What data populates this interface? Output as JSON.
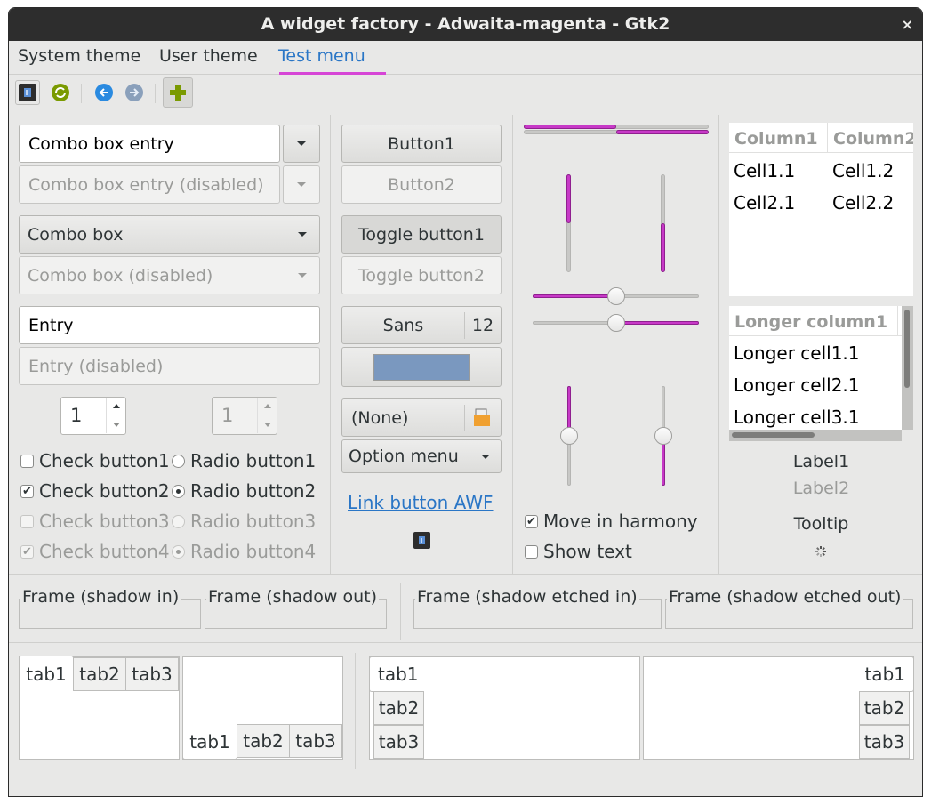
{
  "window": {
    "title": "A widget factory - Adwaita-magenta - Gtk2",
    "close_glyph": "×"
  },
  "menubar": {
    "items": [
      "System theme",
      "User theme",
      "Test menu"
    ],
    "active_index": 2
  },
  "toolbar": {
    "buttons": [
      {
        "icon": "application-icon",
        "glyph": "▮"
      },
      {
        "icon": "refresh-icon",
        "glyph": "⟳"
      },
      {
        "icon": "back-icon",
        "glyph": "←"
      },
      {
        "icon": "forward-icon",
        "glyph": "→"
      },
      {
        "icon": "add-icon",
        "glyph": "✚"
      }
    ]
  },
  "left": {
    "combo_entry": {
      "value": "Combo box entry"
    },
    "combo_entry_disabled": {
      "value": "Combo box entry (disabled)"
    },
    "combo": {
      "value": "Combo box"
    },
    "combo_disabled": {
      "value": "Combo box (disabled)"
    },
    "entry": {
      "value": "Entry"
    },
    "entry_disabled": {
      "value": "Entry (disabled)"
    },
    "spin1": {
      "value": "1"
    },
    "spin2": {
      "value": "1"
    },
    "checks": [
      {
        "label": "Check button1",
        "checked": false,
        "disabled": false
      },
      {
        "label": "Check button2",
        "checked": true,
        "disabled": false
      },
      {
        "label": "Check button3",
        "checked": false,
        "disabled": true
      },
      {
        "label": "Check button4",
        "checked": true,
        "disabled": true
      }
    ],
    "radios": [
      {
        "label": "Radio button1",
        "selected": false,
        "disabled": false
      },
      {
        "label": "Radio button2",
        "selected": true,
        "disabled": false
      },
      {
        "label": "Radio button3",
        "selected": false,
        "disabled": true
      },
      {
        "label": "Radio button4",
        "selected": true,
        "disabled": true
      }
    ],
    "check_glyph": "✔"
  },
  "middle": {
    "button1": "Button1",
    "button2": "Button2",
    "toggle1": "Toggle button1",
    "toggle2": "Toggle button2",
    "font_name": "Sans",
    "font_size": "12",
    "color_swatch": "#7a98bf",
    "file_chooser": "(None)",
    "option_menu": "Option menu",
    "link": "Link button AWF"
  },
  "sliders": {
    "accent": "#c739c7",
    "progress_h1": 0.5,
    "progress_h2": 0.5,
    "progress_v1": 0.5,
    "progress_v2": 0.5,
    "scale_h1": 0.5,
    "scale_h2": 0.5,
    "scale_v1": 0.5,
    "scale_v2": 0.5,
    "move_in_harmony": {
      "label": "Move in harmony",
      "checked": true
    },
    "show_text": {
      "label": "Show text",
      "checked": false
    }
  },
  "right": {
    "tree1": {
      "columns": [
        "Column1",
        "Column2"
      ],
      "rows": [
        [
          "Cell1.1",
          "Cell1.2"
        ],
        [
          "Cell2.1",
          "Cell2.2"
        ]
      ]
    },
    "tree2": {
      "columns": [
        "Longer column1"
      ],
      "rows": [
        "Longer cell1.1",
        "Longer cell2.1",
        "Longer cell3.1"
      ]
    },
    "label1": "Label1",
    "label2": "Label2",
    "tooltip": "Tooltip"
  },
  "frames": [
    "Frame (shadow in)",
    "Frame (shadow out)",
    "Frame (shadow etched in)",
    "Frame (shadow etched out)"
  ],
  "notebooks": [
    {
      "position": "top",
      "tabs": [
        "tab1",
        "tab2",
        "tab3"
      ],
      "active": 0
    },
    {
      "position": "bottom",
      "tabs": [
        "tab1",
        "tab2",
        "tab3"
      ],
      "active": 0
    },
    {
      "position": "left",
      "tabs": [
        "tab1",
        "tab2",
        "tab3"
      ],
      "active": 0
    },
    {
      "position": "right",
      "tabs": [
        "tab1",
        "tab2",
        "tab3"
      ],
      "active": 0
    }
  ]
}
